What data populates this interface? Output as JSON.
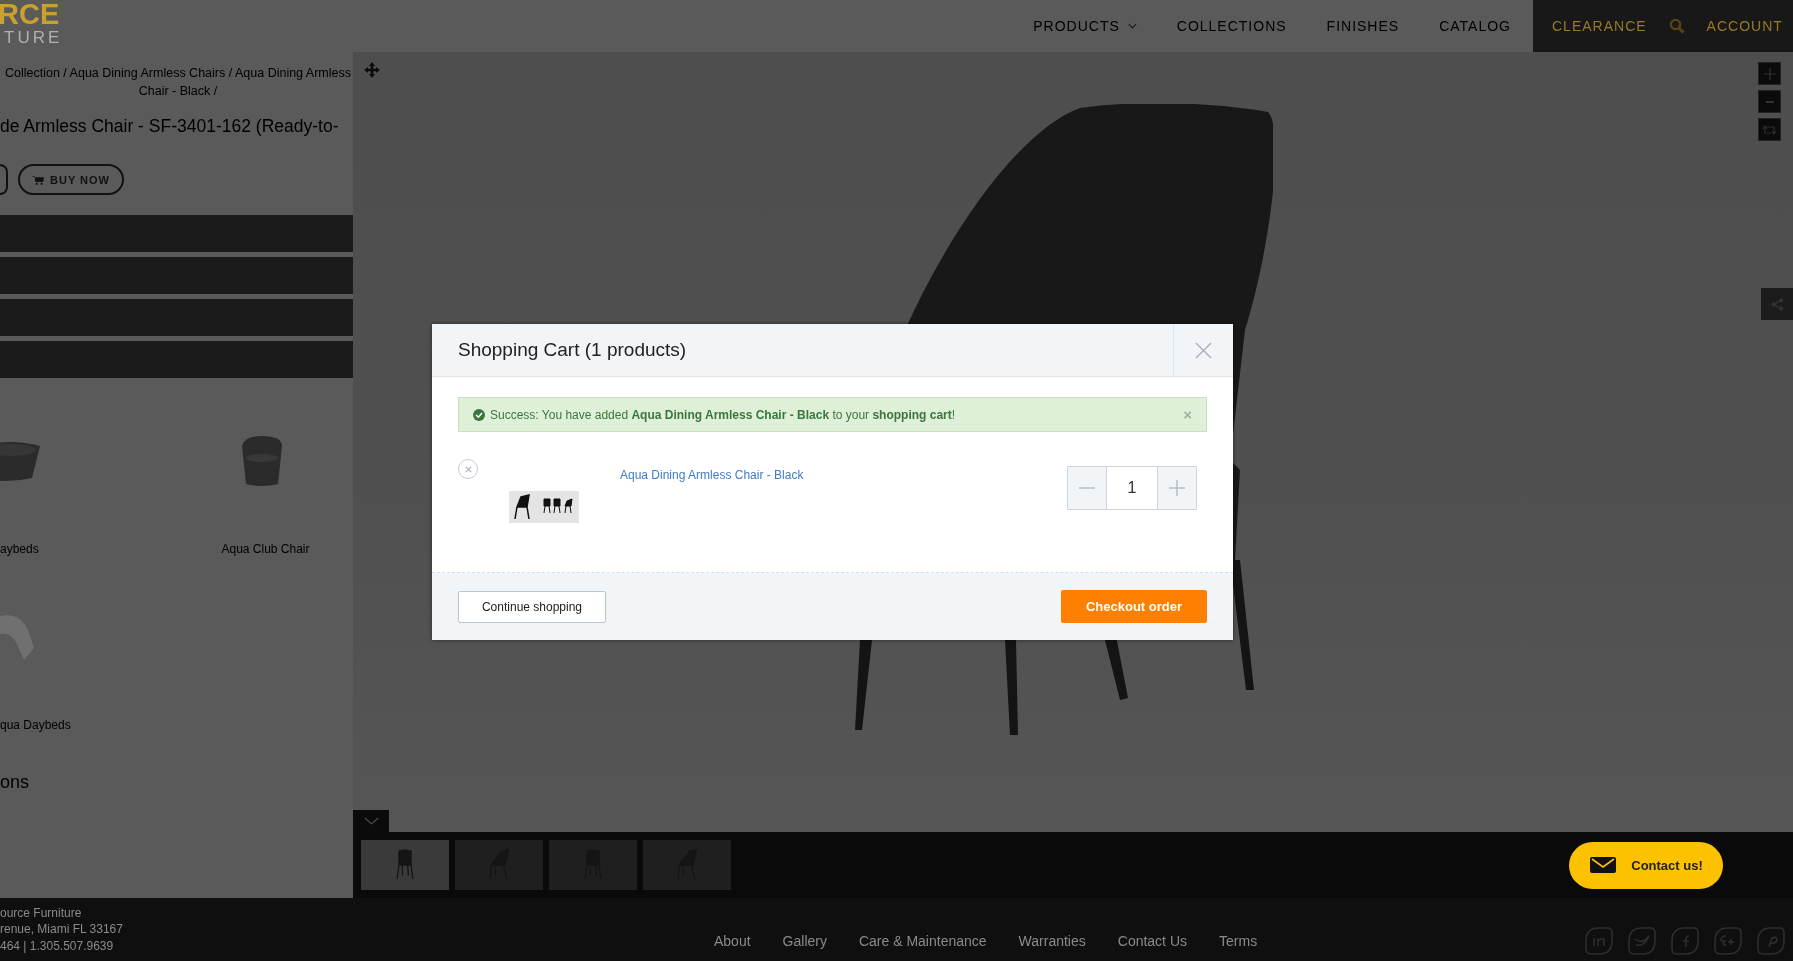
{
  "header": {
    "logo_lines": [
      "RCE",
      "TURE"
    ],
    "nav": [
      {
        "label": "PRODUCTS",
        "dropdown": true
      },
      {
        "label": "COLLECTIONS",
        "dropdown": false
      },
      {
        "label": "FINISHES",
        "dropdown": false
      },
      {
        "label": "CATALOG",
        "dropdown": false
      }
    ],
    "highlight_nav": [
      {
        "label": "CLEARANCE",
        "kind": "link"
      },
      {
        "kind": "search"
      },
      {
        "label": "ACCOUNT",
        "kind": "link"
      }
    ]
  },
  "breadcrumb": "Collection / Aqua Dining Armless Chairs / Aqua Dining Armless Chair - Black /",
  "product_title": "de Armless Chair - SF-3401-162 (Ready-to-",
  "buy_button": "BUY NOW",
  "related": [
    {
      "name": "aybeds",
      "kind": "daybed"
    },
    {
      "name": "Aqua Club Chair",
      "kind": "club"
    },
    {
      "name": "qua Daybeds",
      "kind": "lounger"
    }
  ],
  "section_heading": "ons",
  "thumbnails": [
    {
      "selected": true
    },
    {
      "selected": false
    },
    {
      "selected": false
    },
    {
      "selected": false
    }
  ],
  "contact_button": "Contact us!",
  "footer": {
    "address_lines": [
      "ource Furniture",
      "renue, Miami FL 33167",
      "464 | 1.305.507.9639"
    ],
    "links": [
      "About",
      "Gallery",
      "Care & Maintenance",
      "Warranties",
      "Contact Us",
      "Terms"
    ]
  },
  "modal": {
    "title": "Shopping Cart (1 products)",
    "alert": {
      "text": "Success: You have added **Aqua Dining Armless Chair - Black** to your **shopping cart**!",
      "dismiss": "×"
    },
    "items": [
      {
        "name": "Aqua Dining Armless Chair - Black",
        "quantity": "1"
      }
    ],
    "continue_button": "Continue shopping",
    "checkout_button": "Checkout order"
  }
}
